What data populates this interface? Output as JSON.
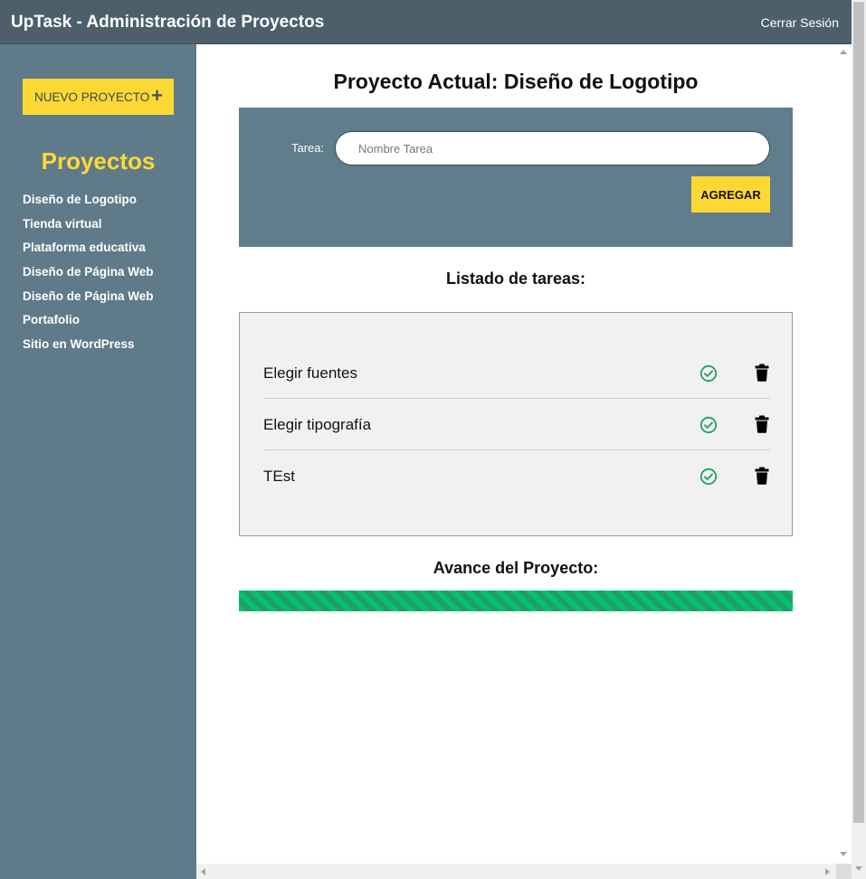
{
  "header": {
    "title": "UpTask - Administración de Proyectos",
    "logout_label": "Cerrar Sesión"
  },
  "sidebar": {
    "new_project_label": "NUEVO PROYECTO",
    "new_project_icon": "plus-icon",
    "projects_heading": "Proyectos",
    "projects": [
      {
        "label": "Diseño de Logotipo"
      },
      {
        "label": "Tienda virtual"
      },
      {
        "label": "Plataforma educativa"
      },
      {
        "label": "Diseño de Página Web"
      },
      {
        "label": "Diseño de Página Web"
      },
      {
        "label": "Portafolio"
      },
      {
        "label": "Sitio en WordPress"
      }
    ]
  },
  "main": {
    "title_prefix": "Proyecto Actual:",
    "title_project": "Diseño de Logotipo",
    "form": {
      "task_label": "Tarea:",
      "task_placeholder": "Nombre Tarea",
      "task_value": "",
      "add_label": "AGREGAR"
    },
    "list_heading": "Listado de tareas:",
    "tasks": [
      {
        "name": "Elegir fuentes",
        "done_icon": "check-circle-icon",
        "delete_icon": "trash-icon"
      },
      {
        "name": "Elegir tipografía",
        "done_icon": "check-circle-icon",
        "delete_icon": "trash-icon"
      },
      {
        "name": "TEst",
        "done_icon": "check-circle-icon",
        "delete_icon": "trash-icon"
      }
    ],
    "progress_heading": "Avance del Proyecto:",
    "progress_percent": 100
  },
  "colors": {
    "header_bg": "#4d5f6b",
    "sidebar_bg": "#5f7b89",
    "accent_yellow": "#fdd835",
    "form_bg": "#607d8b",
    "check_green": "#1fa060",
    "progress_green": "#00c176"
  }
}
